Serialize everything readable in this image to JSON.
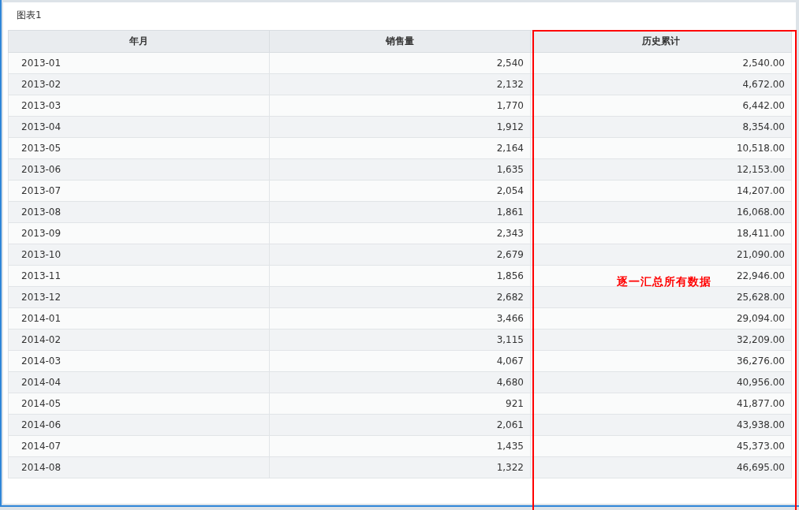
{
  "panel": {
    "title": "图表1"
  },
  "table": {
    "columns": [
      "年月",
      "销售量",
      "历史累计"
    ],
    "rows": [
      [
        "2013-01",
        "2,540",
        "2,540.00"
      ],
      [
        "2013-02",
        "2,132",
        "4,672.00"
      ],
      [
        "2013-03",
        "1,770",
        "6,442.00"
      ],
      [
        "2013-04",
        "1,912",
        "8,354.00"
      ],
      [
        "2013-05",
        "2,164",
        "10,518.00"
      ],
      [
        "2013-06",
        "1,635",
        "12,153.00"
      ],
      [
        "2013-07",
        "2,054",
        "14,207.00"
      ],
      [
        "2013-08",
        "1,861",
        "16,068.00"
      ],
      [
        "2013-09",
        "2,343",
        "18,411.00"
      ],
      [
        "2013-10",
        "2,679",
        "21,090.00"
      ],
      [
        "2013-11",
        "1,856",
        "22,946.00"
      ],
      [
        "2013-12",
        "2,682",
        "25,628.00"
      ],
      [
        "2014-01",
        "3,466",
        "29,094.00"
      ],
      [
        "2014-02",
        "3,115",
        "32,209.00"
      ],
      [
        "2014-03",
        "4,067",
        "36,276.00"
      ],
      [
        "2014-04",
        "4,680",
        "40,956.00"
      ],
      [
        "2014-05",
        "921",
        "41,877.00"
      ],
      [
        "2014-06",
        "2,061",
        "43,938.00"
      ],
      [
        "2014-07",
        "1,435",
        "45,373.00"
      ],
      [
        "2014-08",
        "1,322",
        "46,695.00"
      ]
    ]
  },
  "annotation": {
    "text": "逐一汇总所有数据"
  }
}
